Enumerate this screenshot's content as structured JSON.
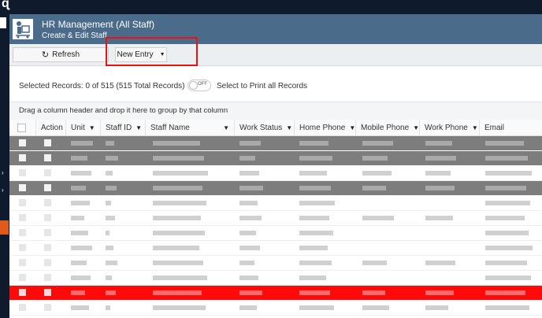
{
  "header": {
    "title": "HR Management (All Staff)",
    "subtitle": "Create & Edit Staff"
  },
  "toolbar": {
    "refresh_label": "Refresh",
    "new_entry_label": "New Entry"
  },
  "selection": {
    "text": "Selected Records: 0 of 515 (515 Total Records)",
    "toggle_state": "OFF",
    "toggle_label": "Select to Print all Records"
  },
  "grouping_hint": "Drag a column header and drop it here to group by that column",
  "columns": [
    "Action",
    "Unit",
    "Staff ID",
    "Staff Name",
    "Work Status",
    "Home Phone",
    "Mobile Phone",
    "Work Phone",
    "Email"
  ],
  "colors": {
    "header_bg": "#4a6b8a",
    "highlight_red": "#ff0a0a",
    "highlight_dark": "#7d7d7d",
    "annotation_red": "#e11111"
  },
  "icons": {
    "app": "staff-dolly-icon",
    "refresh": "refresh-icon",
    "dropdown": "caret-down-icon",
    "filter": "filter-icon"
  }
}
